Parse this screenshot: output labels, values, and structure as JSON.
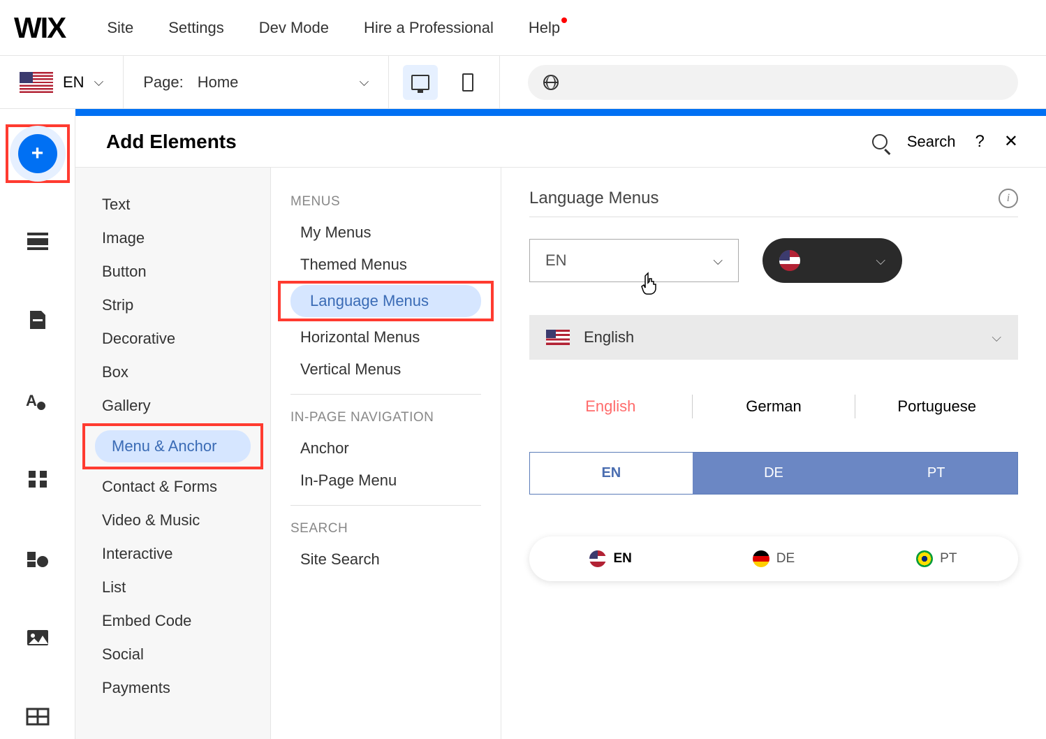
{
  "logo": "WIX",
  "topmenu": [
    "Site",
    "Settings",
    "Dev Mode",
    "Hire a Professional",
    "Help"
  ],
  "toolbar": {
    "lang_code": "EN",
    "page_label": "Page:",
    "page_name": "Home"
  },
  "panel": {
    "title": "Add Elements",
    "search": "Search"
  },
  "categories": [
    "Text",
    "Image",
    "Button",
    "Strip",
    "Decorative",
    "Box",
    "Gallery",
    "Menu & Anchor",
    "Contact & Forms",
    "Video & Music",
    "Interactive",
    "List",
    "Embed Code",
    "Social",
    "Payments"
  ],
  "selected_category_index": 7,
  "menu_sections": [
    {
      "header": "MENUS",
      "items": [
        "My Menus",
        "Themed Menus",
        "Language Menus",
        "Horizontal Menus",
        "Vertical Menus"
      ]
    },
    {
      "header": "IN-PAGE NAVIGATION",
      "items": [
        "Anchor",
        "In-Page Menu"
      ]
    },
    {
      "header": "SEARCH",
      "items": [
        "Site Search"
      ]
    }
  ],
  "selected_menu_item": "Language Menus",
  "preview": {
    "title": "Language Menus",
    "dd_en": "EN",
    "row2_label": "English",
    "tabs": [
      "English",
      "German",
      "Portuguese"
    ],
    "codes": [
      "EN",
      "DE",
      "PT"
    ],
    "flag_items": [
      {
        "code": "EN",
        "bold": true
      },
      {
        "code": "DE",
        "bold": false
      },
      {
        "code": "PT",
        "bold": false
      }
    ]
  }
}
